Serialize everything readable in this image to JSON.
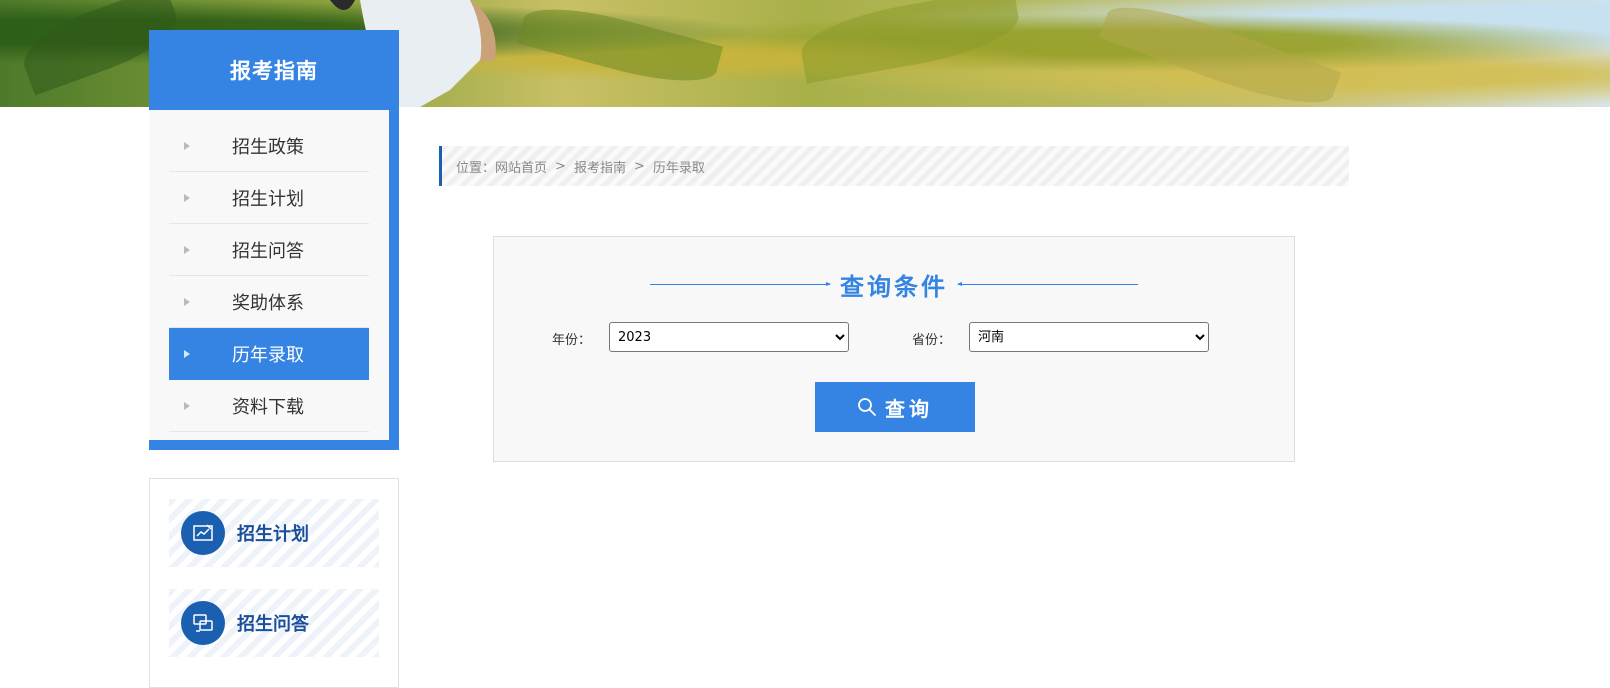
{
  "sidebar": {
    "title": "报考指南",
    "items": [
      {
        "label": "招生政策",
        "active": false
      },
      {
        "label": "招生计划",
        "active": false
      },
      {
        "label": "招生问答",
        "active": false
      },
      {
        "label": "奖助体系",
        "active": false
      },
      {
        "label": "历年录取",
        "active": true
      },
      {
        "label": "资料下载",
        "active": false
      }
    ]
  },
  "quick_links": [
    {
      "label": "招生计划",
      "icon": "plan-icon"
    },
    {
      "label": "招生问答",
      "icon": "qa-icon"
    }
  ],
  "breadcrumb": {
    "prefix": "位置：",
    "items": [
      "网站首页",
      "报考指南",
      "历年录取"
    ],
    "separator": ">"
  },
  "query": {
    "title": "查询条件",
    "year_label": "年份：",
    "year_value": "2023",
    "province_label": "省份：",
    "province_value": "河南",
    "button_label": "查询"
  },
  "colors": {
    "accent": "#3584e4",
    "dark_blue": "#1b5fb0"
  }
}
